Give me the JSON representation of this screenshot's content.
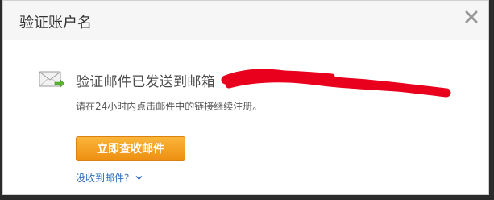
{
  "dialog": {
    "title": "验证账户名",
    "close_icon": "close-icon"
  },
  "message": {
    "mail_icon": "mail-sent-icon",
    "sent_text": "验证邮件已发送到邮箱",
    "hint_text": "请在24小时内点击邮件中的链接继续注册。"
  },
  "actions": {
    "check_mail_label": "立即查收邮件",
    "no_mail_label": "没收到邮件？",
    "no_mail_chevron": "chevron-down-icon"
  },
  "colors": {
    "button_orange": "#f39c1d",
    "link_blue": "#2a6bb8",
    "redaction_red": "#e8001c"
  }
}
